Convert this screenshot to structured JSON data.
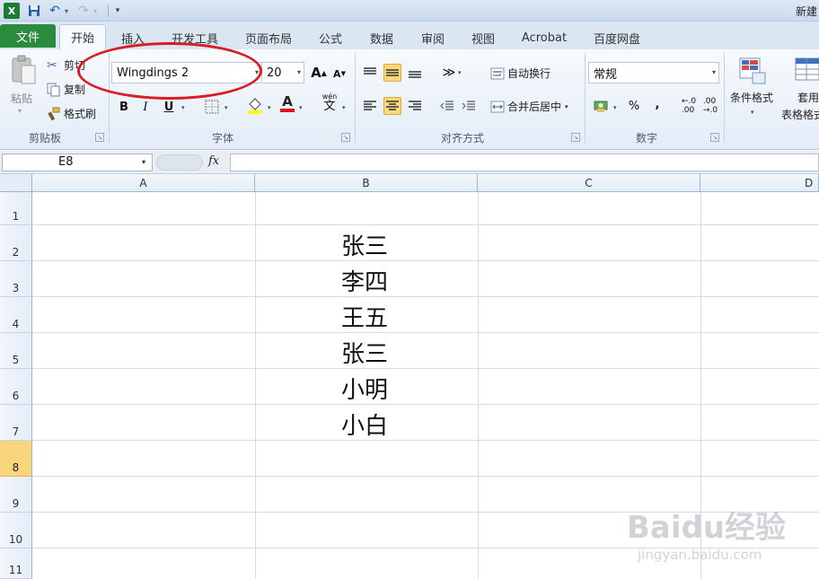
{
  "title_bar": {
    "app_icon": "X",
    "doc_title": "新建"
  },
  "tabs": {
    "file": "文件",
    "items": [
      "开始",
      "插入",
      "开发工具",
      "页面布局",
      "公式",
      "数据",
      "审阅",
      "视图",
      "Acrobat",
      "百度网盘"
    ]
  },
  "clipboard": {
    "paste": "粘贴",
    "cut": "剪切",
    "copy": "复制",
    "format_painter": "格式刷",
    "group_label": "剪贴板"
  },
  "font": {
    "name": "Wingdings 2",
    "size": "20",
    "grow": "A",
    "shrink": "A",
    "bold": "B",
    "italic": "I",
    "underline": "U",
    "font_color_letter": "A",
    "phonetic": "wén",
    "phonetic_char": "文",
    "group_label": "字体"
  },
  "alignment": {
    "wrap_text": "自动换行",
    "merge_center": "合并后居中",
    "group_label": "对齐方式"
  },
  "number": {
    "format": "常规",
    "percent": "%",
    "comma": ",",
    "group_label": "数字"
  },
  "styles": {
    "conditional": "条件格式",
    "table_format_top": "套用",
    "table_format_bottom": "表格格式"
  },
  "formula_bar": {
    "name_box": "E8",
    "fx": "fx",
    "value": ""
  },
  "sheet": {
    "columns": [
      "A",
      "B",
      "C",
      "D"
    ],
    "rows": [
      "1",
      "2",
      "3",
      "4",
      "5",
      "6",
      "7",
      "8",
      "9",
      "10",
      "11"
    ],
    "selected_row": "8",
    "b_values": [
      "张三",
      "李四",
      "王五",
      "张三",
      "小明",
      "小白"
    ]
  },
  "watermark": {
    "brand": "Baidu经验",
    "url": "jingyan.baidu.com"
  },
  "colors": {
    "file_tab": "#2a8a3d",
    "annotation": "#d81d24",
    "selection": "#f9d67c"
  }
}
